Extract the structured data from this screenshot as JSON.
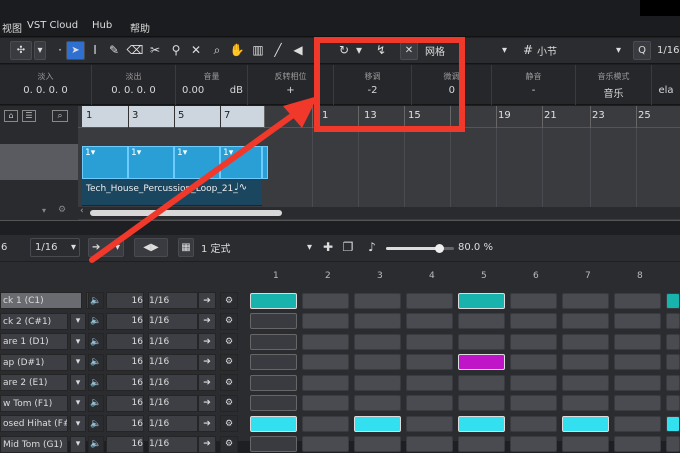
{
  "menubar": {
    "items": [
      "视图",
      "VST Cloud",
      "Hub",
      "帮助"
    ]
  },
  "toolbar": {
    "grid_label": "网格",
    "quantize_value": "小节",
    "quantize_preset": "1/16",
    "q_label": "Q"
  },
  "infoline": {
    "columns": [
      {
        "header": "淡入",
        "value": "0. 0. 0. 0"
      },
      {
        "header": "淡出",
        "value": "0. 0. 0. 0"
      },
      {
        "header": "音量",
        "value": "0.00",
        "unit": "dB"
      },
      {
        "header": "反转相位",
        "value": "+"
      },
      {
        "header": "移调",
        "value": "-2"
      },
      {
        "header": "微调",
        "value": "0"
      },
      {
        "header": "静音",
        "value": "-"
      },
      {
        "header": "音乐模式",
        "value": "音乐"
      },
      {
        "header": "",
        "value": "ela"
      }
    ]
  },
  "ruler": {
    "labels": [
      "1",
      "3",
      "5",
      "7",
      "1",
      "13",
      "15",
      "19",
      "21",
      "23",
      "25"
    ]
  },
  "event": {
    "name": "Tech_House_Percussion_Loop_21_"
  },
  "editor_toolbar": {
    "left_value": "6",
    "quantize": "1/16",
    "pattern": "1 定式",
    "swing_percent": "80.0 %",
    "swing_level": 0.78
  },
  "beats": [
    "1",
    "2",
    "3",
    "4",
    "5",
    "6",
    "7",
    "8"
  ],
  "lanes": [
    {
      "name": "ck 1 (C1)",
      "velocity": "16",
      "length": "1/16",
      "steps": [
        1,
        0,
        0,
        0,
        1,
        0,
        0,
        0
      ]
    },
    {
      "name": "ck 2 (C#1)",
      "velocity": "16",
      "length": "1/16",
      "steps": [
        0,
        0,
        0,
        0,
        0,
        0,
        0,
        0
      ]
    },
    {
      "name": "are 1 (D1)",
      "velocity": "16",
      "length": "1/16",
      "steps": [
        0,
        0,
        0,
        0,
        0,
        0,
        0,
        0
      ]
    },
    {
      "name": "ap (D#1)",
      "velocity": "16",
      "length": "1/16",
      "steps": [
        0,
        0,
        0,
        0,
        2,
        0,
        0,
        0
      ]
    },
    {
      "name": "are 2 (E1)",
      "velocity": "16",
      "length": "1/16",
      "steps": [
        0,
        0,
        0,
        0,
        0,
        0,
        0,
        0
      ]
    },
    {
      "name": "w Tom (F1)",
      "velocity": "16",
      "length": "1/16",
      "steps": [
        0,
        0,
        0,
        0,
        0,
        0,
        0,
        0
      ]
    },
    {
      "name": "osed Hihat (F#1)",
      "velocity": "16",
      "length": "1/16",
      "steps": [
        3,
        0,
        3,
        0,
        3,
        0,
        3,
        0
      ]
    },
    {
      "name": "Mid Tom (G1)",
      "velocity": "16",
      "length": "1/16",
      "steps": [
        0,
        0,
        0,
        0,
        0,
        0,
        0,
        0
      ]
    }
  ],
  "colors": {
    "accent_teal": "#17b3ac",
    "accent_cyan": "#33e0ef",
    "accent_magenta": "#c014c8",
    "part_blue": "#2a9fd6",
    "callout_red": "#f0392b"
  }
}
